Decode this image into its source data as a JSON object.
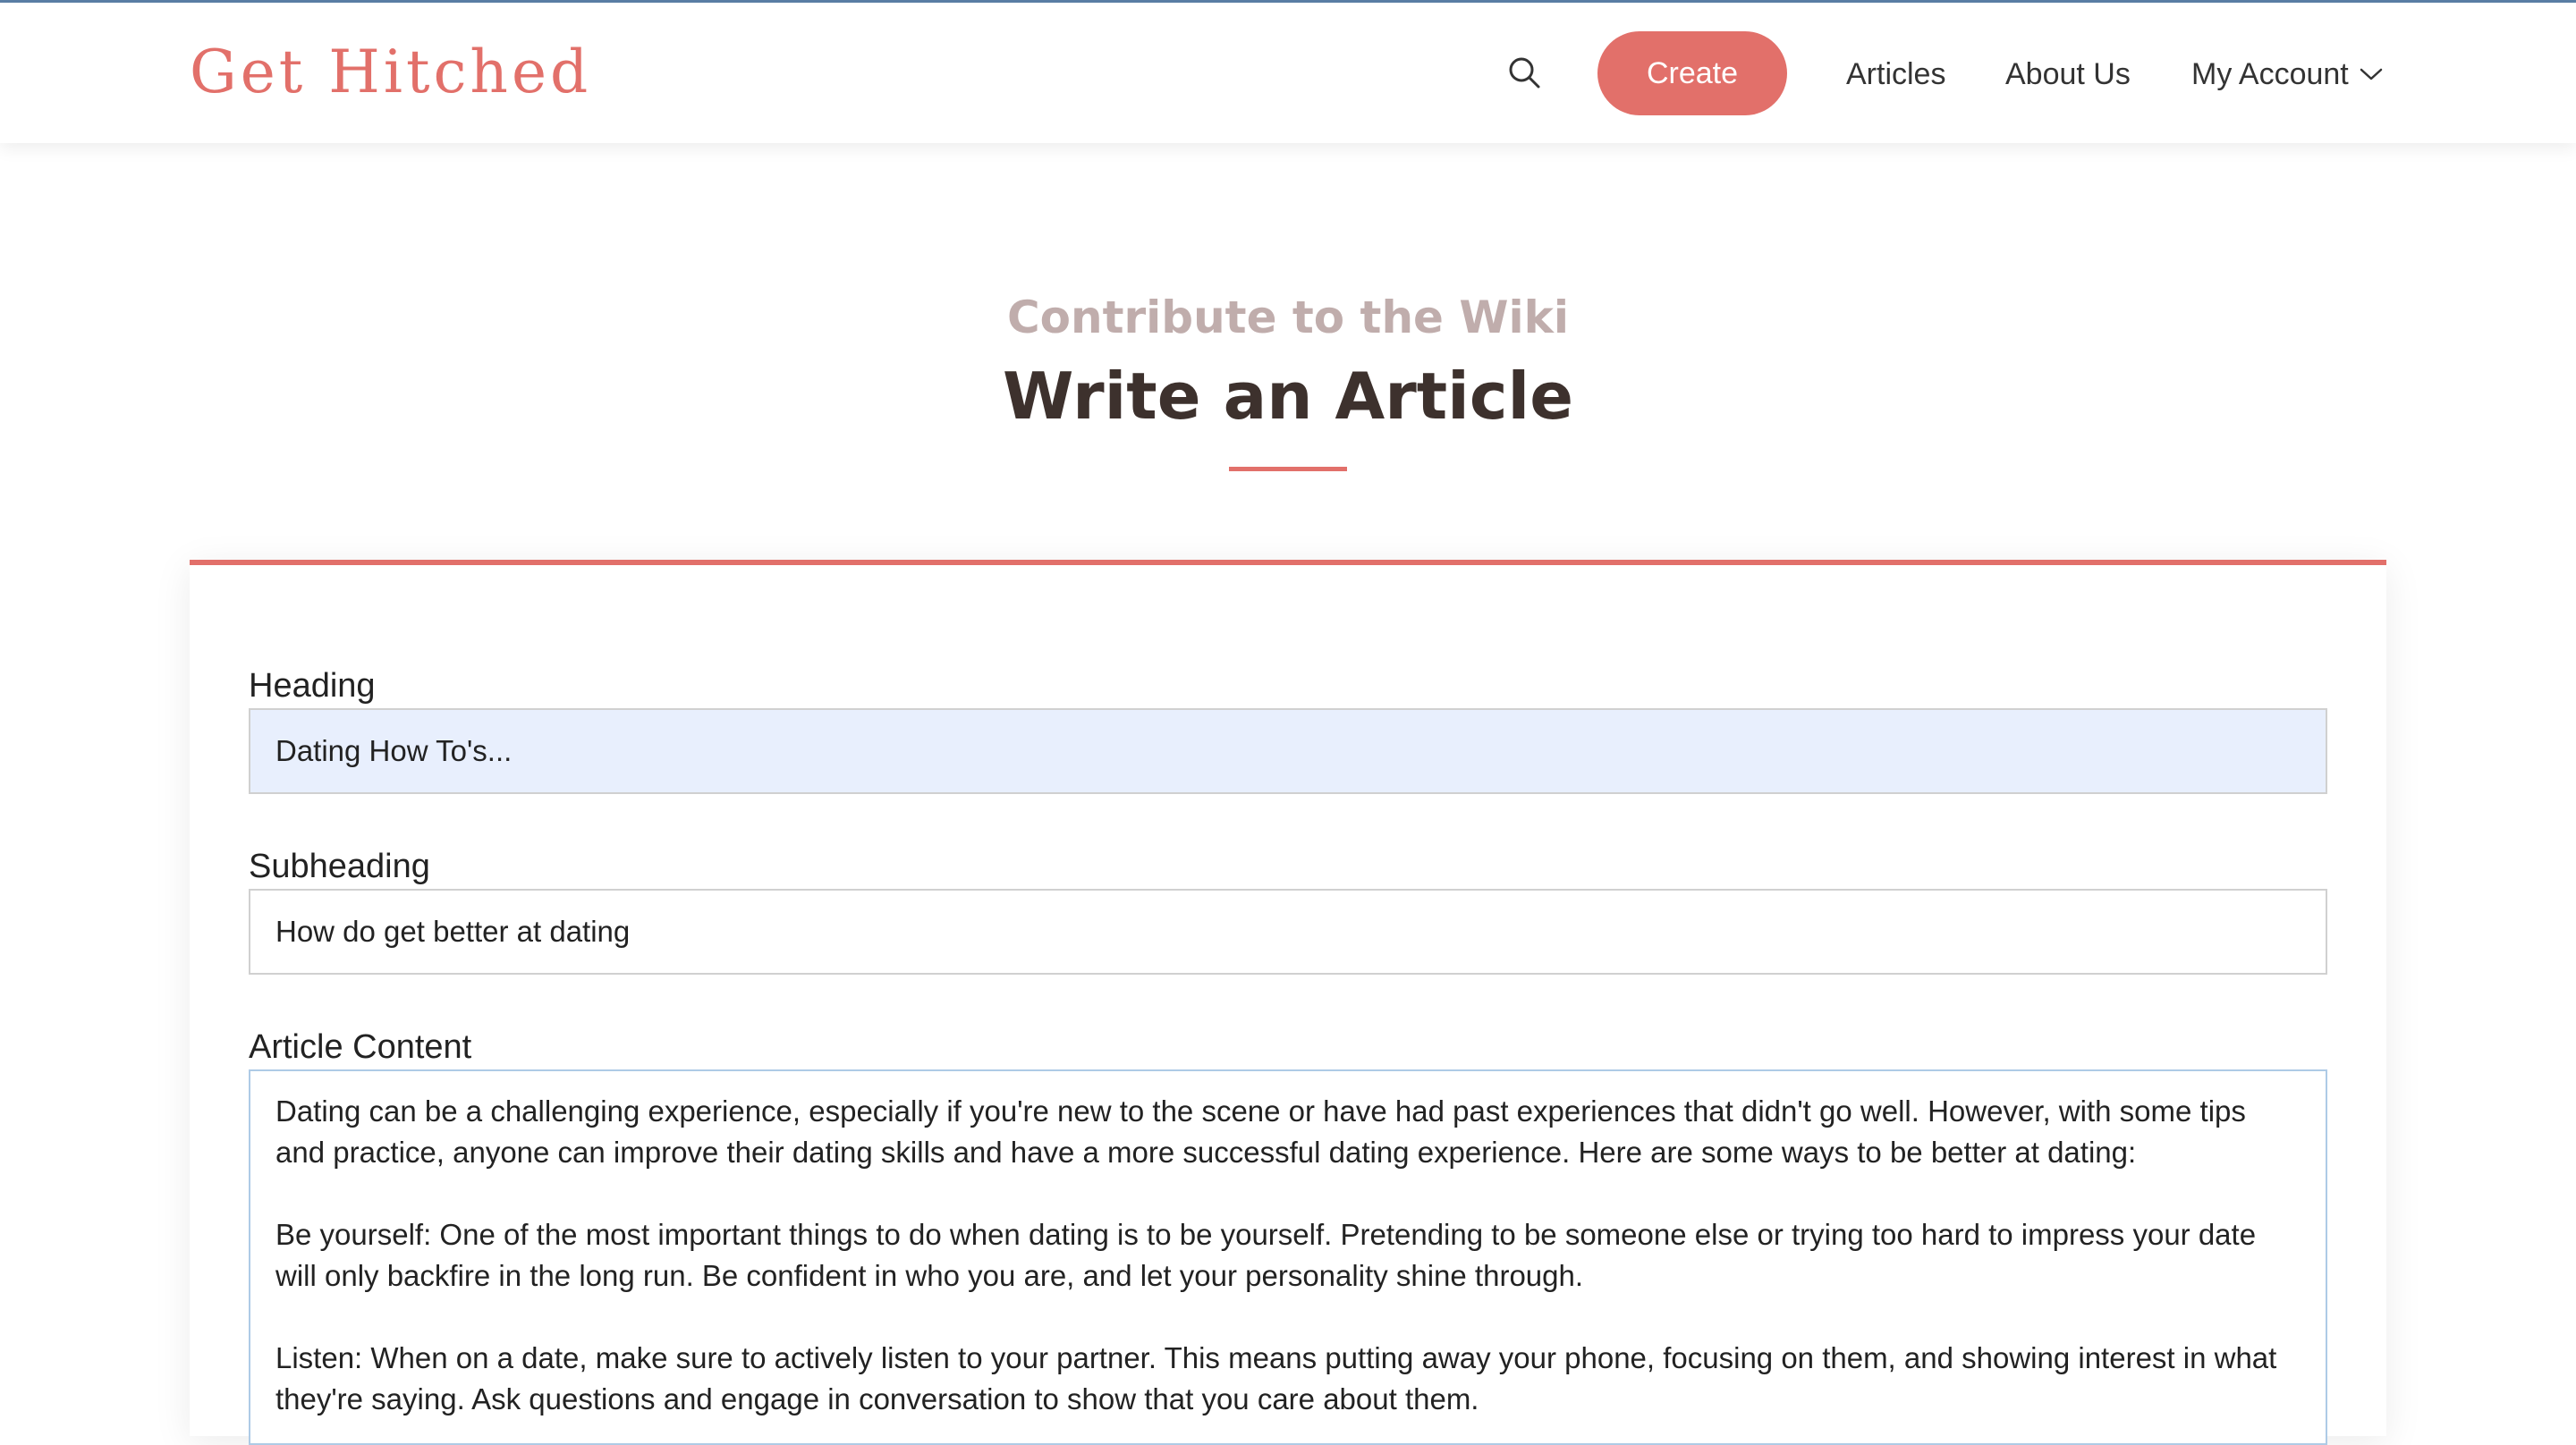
{
  "colors": {
    "brand": "#e2706a",
    "heading_dark": "#3d312d",
    "subtitle_muted": "#c0adac",
    "autofill_bg": "#e8effd",
    "focus_border": "#aecbe6"
  },
  "header": {
    "brand": "Get Hitched",
    "search_icon": "search-icon",
    "create_label": "Create",
    "nav": {
      "articles": "Articles",
      "about": "About Us",
      "account": "My Account",
      "account_icon": "chevron-down-icon"
    }
  },
  "hero": {
    "subtitle": "Contribute to the Wiki",
    "title": "Write an Article"
  },
  "form": {
    "heading": {
      "label": "Heading",
      "value": "Dating How To's..."
    },
    "subheading": {
      "label": "Subheading",
      "value": "How do get better at dating"
    },
    "content": {
      "label": "Article Content",
      "paragraphs": [
        "Dating can be a challenging experience, especially if you're new to the scene or have had past experiences that didn't go well. However, with some tips and practice, anyone can improve their dating skills and have a more successful dating experience. Here are some ways to be better at dating:",
        "Be yourself: One of the most important things to do when dating is to be yourself. Pretending to be someone else or trying too hard to impress your date will only backfire in the long run. Be confident in who you are, and let your personality shine through.",
        "Listen: When on a date, make sure to actively listen to your partner. This means putting away your phone, focusing on them, and showing interest in what they're saying. Ask questions and engage in conversation to show that you care about them."
      ]
    }
  }
}
